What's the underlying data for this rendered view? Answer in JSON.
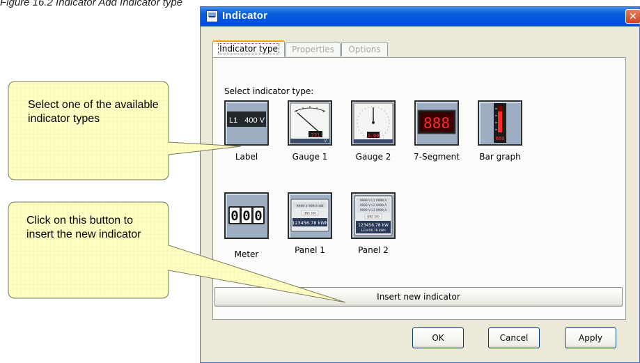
{
  "page_caption": "Figure 16.2 Indicator Add Indicator type",
  "window": {
    "title": "Indicator",
    "close_glyph": "✕"
  },
  "tabs": [
    {
      "label": "Indicator type",
      "state": "active"
    },
    {
      "label": "Properties",
      "state": "disabled"
    },
    {
      "label": "Options",
      "state": "disabled"
    }
  ],
  "panel": {
    "select_label": "Select indicator type:",
    "indicators": [
      {
        "label": "Label",
        "icon": "label-icon",
        "preview_left": "L1",
        "preview_right": "400 V"
      },
      {
        "label": "Gauge 1",
        "icon": "analog-gauge-icon",
        "readout": "231",
        "scale": "V"
      },
      {
        "label": "Gauge 2",
        "icon": "dial-gauge-icon",
        "readout": "1.00"
      },
      {
        "label": "7-Segment",
        "icon": "seven-segment-icon",
        "digits": "888"
      },
      {
        "label": "Bar graph",
        "icon": "bar-graph-icon",
        "readout": "888"
      },
      {
        "label": "Meter",
        "icon": "meter-counter-icon",
        "digits": [
          "0",
          "0",
          "0"
        ]
      },
      {
        "label": "Panel 1",
        "icon": "panel-1-icon",
        "line1": "9999 V   999,9 kW",
        "line2": "DNS 300",
        "line3": "123456.78 kWh"
      },
      {
        "label": "Panel 2",
        "icon": "panel-2-icon",
        "line1": "9999 V  L1  9999 A",
        "line2": "9999 V  L2  9999 A",
        "line3": "9999 V  L3  9999 A",
        "line4": "DNS 300",
        "line5": "123456.78 kW",
        "line6": "123456.78 kWh"
      }
    ],
    "insert_button": "Insert new indicator"
  },
  "buttons": {
    "ok": "OK",
    "cancel": "Cancel",
    "apply": "Apply"
  },
  "callouts": {
    "select": "Select one of the available indicator types",
    "insert": "Click on this button to insert the new indicator"
  },
  "colors": {
    "titlebar": "#0054e3",
    "dialog_bg": "#ece9d8",
    "callout_fill": "#ffffc0",
    "tile_bg": "#9eaec2",
    "display_red": "#ff2a2a"
  }
}
